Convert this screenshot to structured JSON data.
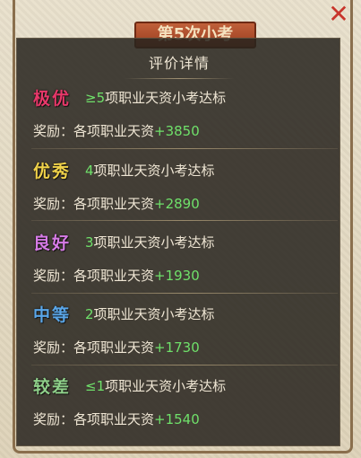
{
  "background": {
    "banner_title": "第5次小考",
    "close_glyph": "✕"
  },
  "dialog": {
    "title": "评价详情",
    "tiers": [
      {
        "name": "极优",
        "color": "#e8386a",
        "cond_num": "≥5",
        "cond_text": "项职业天资小考达标",
        "reward_label": "奖励：各项职业天资",
        "reward_amount": "+3850"
      },
      {
        "name": "优秀",
        "color": "#f0d24a",
        "cond_num": "4",
        "cond_text": "项职业天资小考达标",
        "reward_label": "奖励：各项职业天资",
        "reward_amount": "+2890"
      },
      {
        "name": "良好",
        "color": "#d67be6",
        "cond_num": "3",
        "cond_text": "项职业天资小考达标",
        "reward_label": "奖励：各项职业天资",
        "reward_amount": "+1930"
      },
      {
        "name": "中等",
        "color": "#5aa6e8",
        "cond_num": "2",
        "cond_text": "项职业天资小考达标",
        "reward_label": "奖励：各项职业天资",
        "reward_amount": "+1730"
      },
      {
        "name": "较差",
        "color": "#8fd08a",
        "cond_num": "≤1",
        "cond_text": "项职业天资小考达标",
        "reward_label": "奖励：各项职业天资",
        "reward_amount": "+1540"
      }
    ]
  },
  "colors": {
    "highlight_green": "#6fe06a",
    "text": "#efe6d4"
  }
}
